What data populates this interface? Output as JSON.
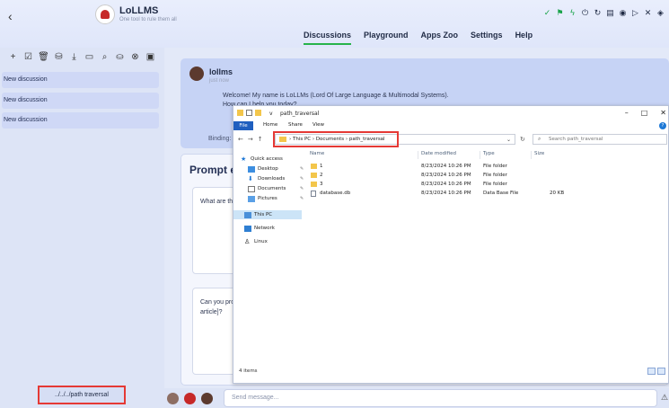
{
  "app": {
    "brand": "LoLLMS",
    "tagline": "One tool to rule them all",
    "back_icon": "chevron-left-icon"
  },
  "nav": {
    "tabs": [
      "Discussions",
      "Playground",
      "Apps Zoo",
      "Settings",
      "Help"
    ],
    "active": "Discussions"
  },
  "sidebar": {
    "discussions": [
      "New discussion",
      "New discussion",
      "New discussion"
    ],
    "footer_label": "../../../path traversal"
  },
  "chat": {
    "sender": "lollms",
    "time": "just now",
    "message": "Welcome! My name is LoLLMs (Lord Of Large Language & Multimodal Systems).",
    "message_line2": "How can I help you today?",
    "binding_label": "Binding:",
    "prompt_title": "Prompt e",
    "prompt1": "What are th",
    "prompt2_line1": "Can you pro",
    "prompt2_line2": "article]?",
    "send_placeholder": "Send message..."
  },
  "explorer": {
    "title": "path_traversal",
    "title_chip": "v",
    "ribbon": [
      "File",
      "Home",
      "Share",
      "View"
    ],
    "breadcrumb": [
      "This PC",
      "Documents",
      "path_traversal"
    ],
    "search_placeholder": "Search path_traversal",
    "nav_items": [
      "Quick access",
      "Desktop",
      "Downloads",
      "Documents",
      "Pictures",
      "This PC",
      "Network",
      "Linux"
    ],
    "columns": [
      "Name",
      "Date modified",
      "Type",
      "Size"
    ],
    "rows": [
      {
        "name": "1",
        "date": "8/23/2024 10:26 PM",
        "type": "File folder",
        "size": ""
      },
      {
        "name": "2",
        "date": "8/23/2024 10:26 PM",
        "type": "File folder",
        "size": ""
      },
      {
        "name": "3",
        "date": "8/23/2024 10:26 PM",
        "type": "File folder",
        "size": ""
      },
      {
        "name": "database.db",
        "date": "8/23/2024 10:26 PM",
        "type": "Data Base File",
        "size": "20 KB"
      }
    ],
    "status": "4 items"
  },
  "colors": {
    "accent_green": "#27b34a",
    "highlight_red": "#e53935",
    "file_tab_blue": "#1f5fbf"
  }
}
